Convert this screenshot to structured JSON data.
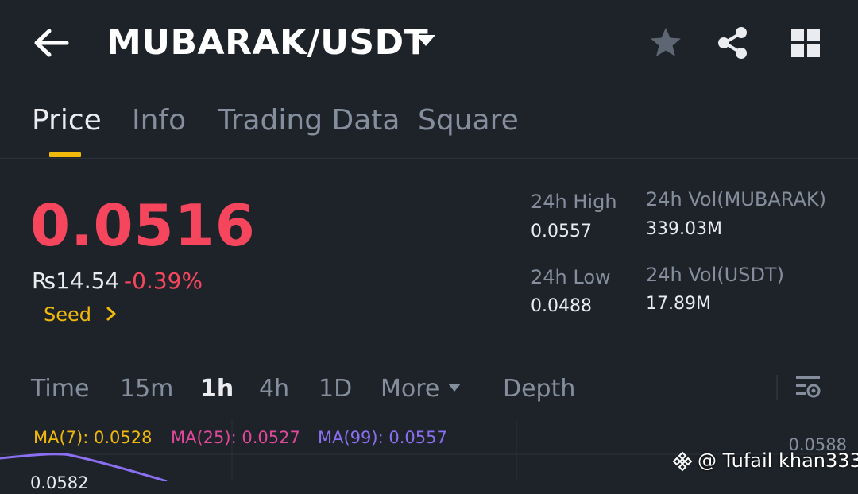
{
  "header": {
    "back_icon": "arrow-left-icon",
    "pair": "MUBARAK/USDT",
    "pair_caret_icon": "caret-down-icon",
    "actions": [
      "star-icon",
      "share-icon",
      "grid-icon"
    ]
  },
  "tabs": [
    {
      "label": "Price",
      "active": true
    },
    {
      "label": "Info",
      "active": false
    },
    {
      "label": "Trading Data",
      "active": false
    },
    {
      "label": "Square",
      "active": false
    }
  ],
  "ticker": {
    "last_price": "0.0516",
    "fiat_price": "₨14.54",
    "change_pct": "-0.39%",
    "tag_link": "Seed",
    "high_label": "24h High",
    "high_value": "0.0557",
    "low_label": "24h Low",
    "low_value": "0.0488",
    "vol_base_label": "24h Vol(MUBARAK)",
    "vol_base_value": "339.03M",
    "vol_quote_label": "24h Vol(USDT)",
    "vol_quote_value": "17.89M"
  },
  "intervals": [
    {
      "label": "Time",
      "active": false
    },
    {
      "label": "15m",
      "active": false
    },
    {
      "label": "1h",
      "active": true
    },
    {
      "label": "4h",
      "active": false
    },
    {
      "label": "1D",
      "active": false
    },
    {
      "label": "More",
      "active": false
    },
    {
      "label": "Depth",
      "active": false
    }
  ],
  "ma": [
    {
      "label": "MA(7): 0.0528",
      "color": "#f0b90b"
    },
    {
      "label": "MA(25): 0.0527",
      "color": "#e0489a"
    },
    {
      "label": "MA(99): 0.0557",
      "color": "#8a6ff0"
    }
  ],
  "chart": {
    "axis_top": "0.0588",
    "visible_low": "0.0582"
  },
  "watermark": {
    "text": "@ Tufail khan333"
  },
  "colors": {
    "background": "#1e2329",
    "up": "#0ecb81",
    "down": "#f6465d",
    "accent": "#f0b90b",
    "muted": "#848e9c"
  }
}
